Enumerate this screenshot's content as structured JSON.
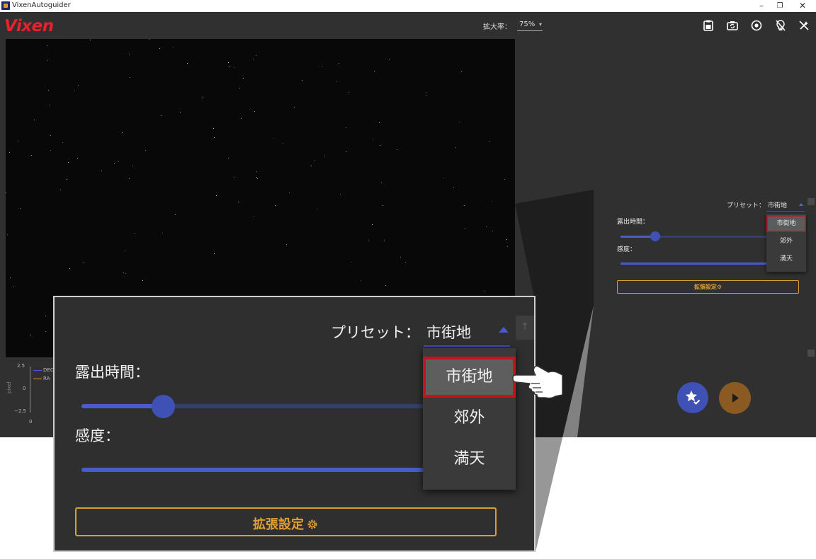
{
  "window": {
    "title": "VixenAutoguider",
    "minimize": "–",
    "restore": "❐",
    "close": "✕"
  },
  "header": {
    "brand": "Vixen",
    "zoom_label": "拡大率：",
    "zoom_value": "75%",
    "icons": [
      "clipboard-icon",
      "camera-rotate-icon",
      "target-icon",
      "bulb-off-icon",
      "guide-off-icon"
    ]
  },
  "graph": {
    "ylabel": "pixel",
    "ticks": [
      "2.5",
      "0",
      "−2.5"
    ],
    "xtick": "0",
    "legend": [
      "DEC",
      "RA"
    ],
    "colors": {
      "dec": "#4a5bd0",
      "ra": "#e0a030"
    }
  },
  "panel": {
    "preset_label": "プリセット：",
    "preset_value": "市街地",
    "exposure_label": "露出時間：",
    "exposure_level": 0.23,
    "sensitivity_label": "感度：",
    "sensitivity_level": 1.0,
    "advanced_label": "拡張設定",
    "preset_options": [
      "市街地",
      "郊外",
      "満天"
    ],
    "selected_option": 0
  },
  "zoomed": {
    "preset_label": "プリセット：",
    "preset_value": "市街地",
    "exposure_label": "露出時間：",
    "sensitivity_label": "感度：",
    "advanced_label": "拡張設定",
    "preset_options": [
      "市街地",
      "郊外",
      "満天"
    ]
  },
  "colors": {
    "accent": "#3f51b5",
    "warning": "#e0a030",
    "brand": "#e8222b",
    "highlight": "#c8101e"
  }
}
